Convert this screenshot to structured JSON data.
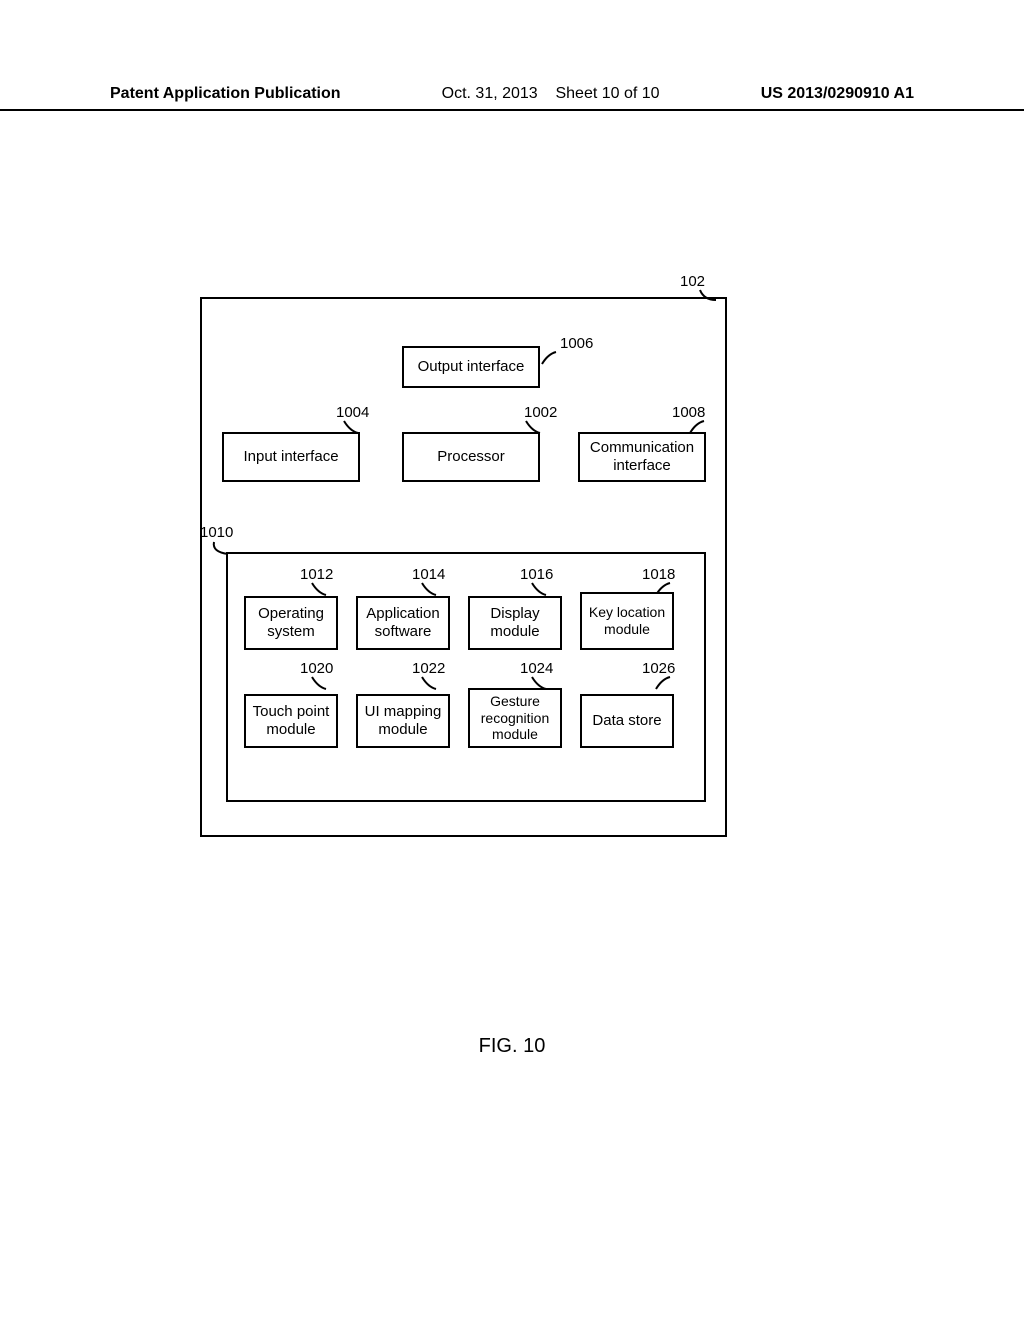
{
  "header": {
    "left": "Patent Application Publication",
    "mid_date": "Oct. 31, 2013",
    "mid_sheet": "Sheet 10 of 10",
    "right": "US 2013/0290910 A1"
  },
  "figure": {
    "caption": "FIG. 10",
    "outer_ref": "102",
    "memory_ref": "1010",
    "blocks": {
      "output_interface": {
        "label": "Output interface",
        "ref": "1006"
      },
      "input_interface": {
        "label": "Input interface",
        "ref": "1004"
      },
      "processor": {
        "label": "Processor",
        "ref": "1002"
      },
      "communication_interface": {
        "label": "Communication interface",
        "ref": "1008"
      },
      "operating_system": {
        "label": "Operating system",
        "ref": "1012"
      },
      "application_software": {
        "label": "Application software",
        "ref": "1014"
      },
      "display_module": {
        "label": "Display module",
        "ref": "1016"
      },
      "key_location_module": {
        "label": "Key location module",
        "ref": "1018"
      },
      "touch_point_module": {
        "label": "Touch point module",
        "ref": "1020"
      },
      "ui_mapping_module": {
        "label": "UI mapping module",
        "ref": "1022"
      },
      "gesture_recognition_module": {
        "label": "Gesture recognition module",
        "ref": "1024"
      },
      "data_store": {
        "label": "Data store",
        "ref": "1026"
      }
    }
  }
}
